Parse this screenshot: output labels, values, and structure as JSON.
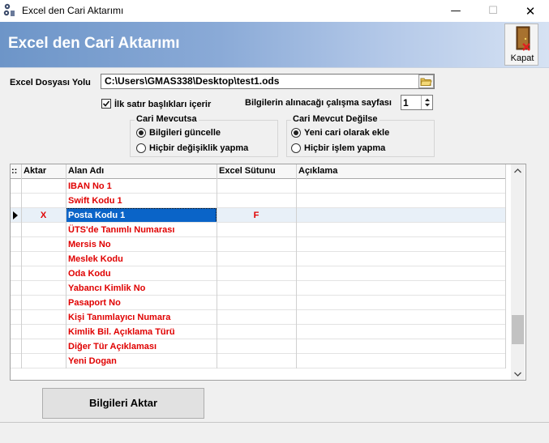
{
  "window": {
    "title": "Excel den Cari Aktarımı",
    "minimize": "—",
    "maximize": "☐",
    "close": "✕"
  },
  "banner": {
    "title": "Excel den Cari Aktarımı",
    "close_label": "Kapat"
  },
  "file": {
    "label": "Excel Dosyası Yolu",
    "path": "C:\\Users\\GMAS338\\Desktop\\test1.ods"
  },
  "options": {
    "first_row_header_label": "İlk satır başlıkları içerir",
    "first_row_header_checked": true,
    "sheet_label": "Bilgilerin alınacağı çalışma sayfası",
    "sheet_value": "1"
  },
  "group_exists": {
    "title": "Cari Mevcutsa",
    "options": [
      "Bilgileri güncelle",
      "Hiçbir değişiklik yapma"
    ],
    "selected": 0
  },
  "group_not_exists": {
    "title": "Cari Mevcut Değilse",
    "options": [
      "Yeni cari olarak ekle",
      "Hiçbir işlem yapma"
    ],
    "selected": 0
  },
  "grid": {
    "corner": "::",
    "columns": [
      "Aktar",
      "Alan Adı",
      "Excel Sütunu",
      "Açıklama"
    ],
    "rows": [
      {
        "aktar": "",
        "alan": "IBAN No 1",
        "sutun": "",
        "aciklama": ""
      },
      {
        "aktar": "",
        "alan": "Swift Kodu 1",
        "sutun": "",
        "aciklama": ""
      },
      {
        "aktar": "X",
        "alan": "Posta Kodu 1",
        "sutun": "F",
        "aciklama": ""
      },
      {
        "aktar": "",
        "alan": "ÜTS'de Tanımlı Numarası",
        "sutun": "",
        "aciklama": ""
      },
      {
        "aktar": "",
        "alan": "Mersis No",
        "sutun": "",
        "aciklama": ""
      },
      {
        "aktar": "",
        "alan": "Meslek Kodu",
        "sutun": "",
        "aciklama": ""
      },
      {
        "aktar": "",
        "alan": "Oda Kodu",
        "sutun": "",
        "aciklama": ""
      },
      {
        "aktar": "",
        "alan": "Yabancı Kimlik No",
        "sutun": "",
        "aciklama": ""
      },
      {
        "aktar": "",
        "alan": "Pasaport No",
        "sutun": "",
        "aciklama": ""
      },
      {
        "aktar": "",
        "alan": "Kişi Tanımlayıcı Numara",
        "sutun": "",
        "aciklama": ""
      },
      {
        "aktar": "",
        "alan": "Kimlik Bil. Açıklama Türü",
        "sutun": "",
        "aciklama": ""
      },
      {
        "aktar": "",
        "alan": "Diğer Tür Açıklaması",
        "sutun": "",
        "aciklama": ""
      },
      {
        "aktar": "",
        "alan": "Yeni Dogan",
        "sutun": "",
        "aciklama": ""
      }
    ],
    "current_row": 2,
    "scroll_up": "⌃",
    "scroll_down": "⌄"
  },
  "actions": {
    "transfer_label": "Bilgileri Aktar"
  },
  "colors": {
    "row_text": "#e00000",
    "selection_bg": "#e8f0f8",
    "selected_cell_bg": "#0a64c8",
    "banner_start": "#6d95c8",
    "banner_end": "#d6e2f3"
  }
}
